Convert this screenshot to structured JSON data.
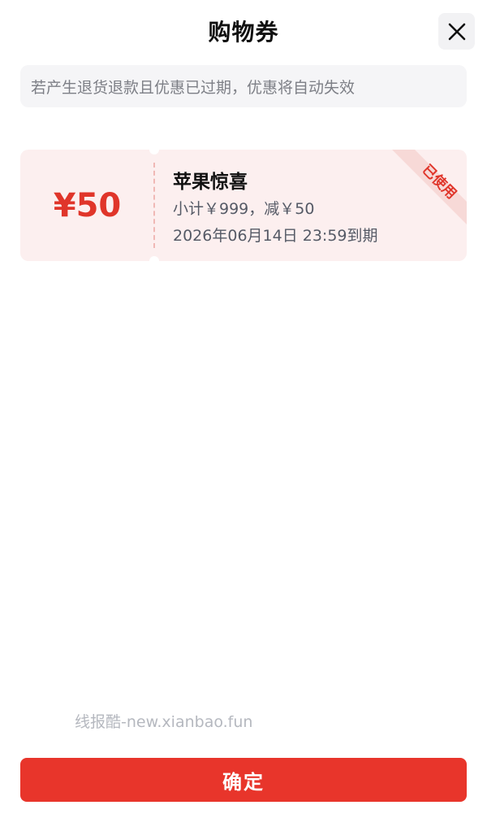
{
  "header": {
    "title": "购物券",
    "close_icon": "close-icon"
  },
  "notice": {
    "text": "若产生退货退款且优惠已过期，优惠将自动失效"
  },
  "coupons": [
    {
      "amount": "¥50",
      "name": "苹果惊喜",
      "condition": "小计￥999，减￥50",
      "expiry": "2026年06月14日  23:59到期",
      "status": "已使用"
    }
  ],
  "watermark": "线报酷-new.xianbao.fun",
  "footer": {
    "confirm_label": "确定"
  },
  "colors": {
    "accent": "#e8352b",
    "coupon_bg": "#fcefef",
    "notice_bg": "#f5f5f7"
  }
}
